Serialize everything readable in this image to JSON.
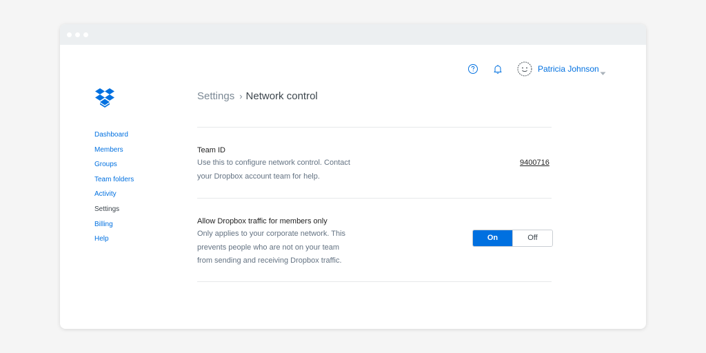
{
  "header": {
    "user_name": "Patricia Johnson",
    "icons": [
      "help-icon",
      "bell-icon",
      "avatar",
      "chevron-down-icon"
    ]
  },
  "brand": {
    "logo": "dropbox-logo"
  },
  "sidebar": {
    "items": [
      {
        "label": "Dashboard"
      },
      {
        "label": "Members"
      },
      {
        "label": "Groups"
      },
      {
        "label": "Team folders"
      },
      {
        "label": "Activity"
      },
      {
        "label": "Settings",
        "active": true
      },
      {
        "label": "Billing"
      },
      {
        "label": "Help"
      }
    ]
  },
  "breadcrumb": {
    "root": "Settings",
    "separator": "›",
    "current": "Network control"
  },
  "settings": {
    "team_id": {
      "title": "Team ID",
      "description": "Use this to configure network control. Contact\nyour Dropbox account team for help.",
      "value": "9400716"
    },
    "traffic": {
      "title": "Allow Dropbox traffic for members only",
      "description": "Only applies to your corporate network. This\nprevents people who are not on your team\nfrom sending and receiving Dropbox traffic.",
      "on_label": "On",
      "off_label": "Off",
      "selected": "On"
    }
  },
  "colors": {
    "accent": "#0070e0",
    "text_dark": "#3d464d",
    "text_muted": "#637282",
    "page_bg": "#f5f5f5",
    "titlebar_bg": "#eceff1"
  }
}
